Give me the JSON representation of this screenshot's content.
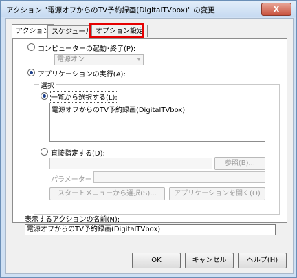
{
  "window": {
    "title": "アクション \"電源オフからのTV予約録画(DigitalTVbox)\" の変更",
    "close_label": "X"
  },
  "tabs": [
    "アクション",
    "スケジュール",
    "オプション設定"
  ],
  "options": {
    "startup_label": "コンピューターの起動･終了(P):",
    "startup_combo_value": "電源オン",
    "run_app_label": "アプリケーションの実行(A):",
    "group_title": "選択",
    "list_select_label": "一覧から選択する(L):",
    "list_items": [
      "電源オフからのTV予約録画(DigitalTVbox)"
    ],
    "direct_label": "直接指定する(D):",
    "browse_button": "参照(B)...",
    "param_label": "パラメーター",
    "start_menu_button": "スタートメニューから選択(S)...",
    "open_app_button": "アプリケーションを開く(O)"
  },
  "action_name": {
    "label": "表示するアクションの名前(N):",
    "value": "電源オフからのTV予約録画(DigitalTVbox)"
  },
  "footer": {
    "ok": "OK",
    "cancel": "キャンセル",
    "help": "ヘルプ(H)"
  }
}
